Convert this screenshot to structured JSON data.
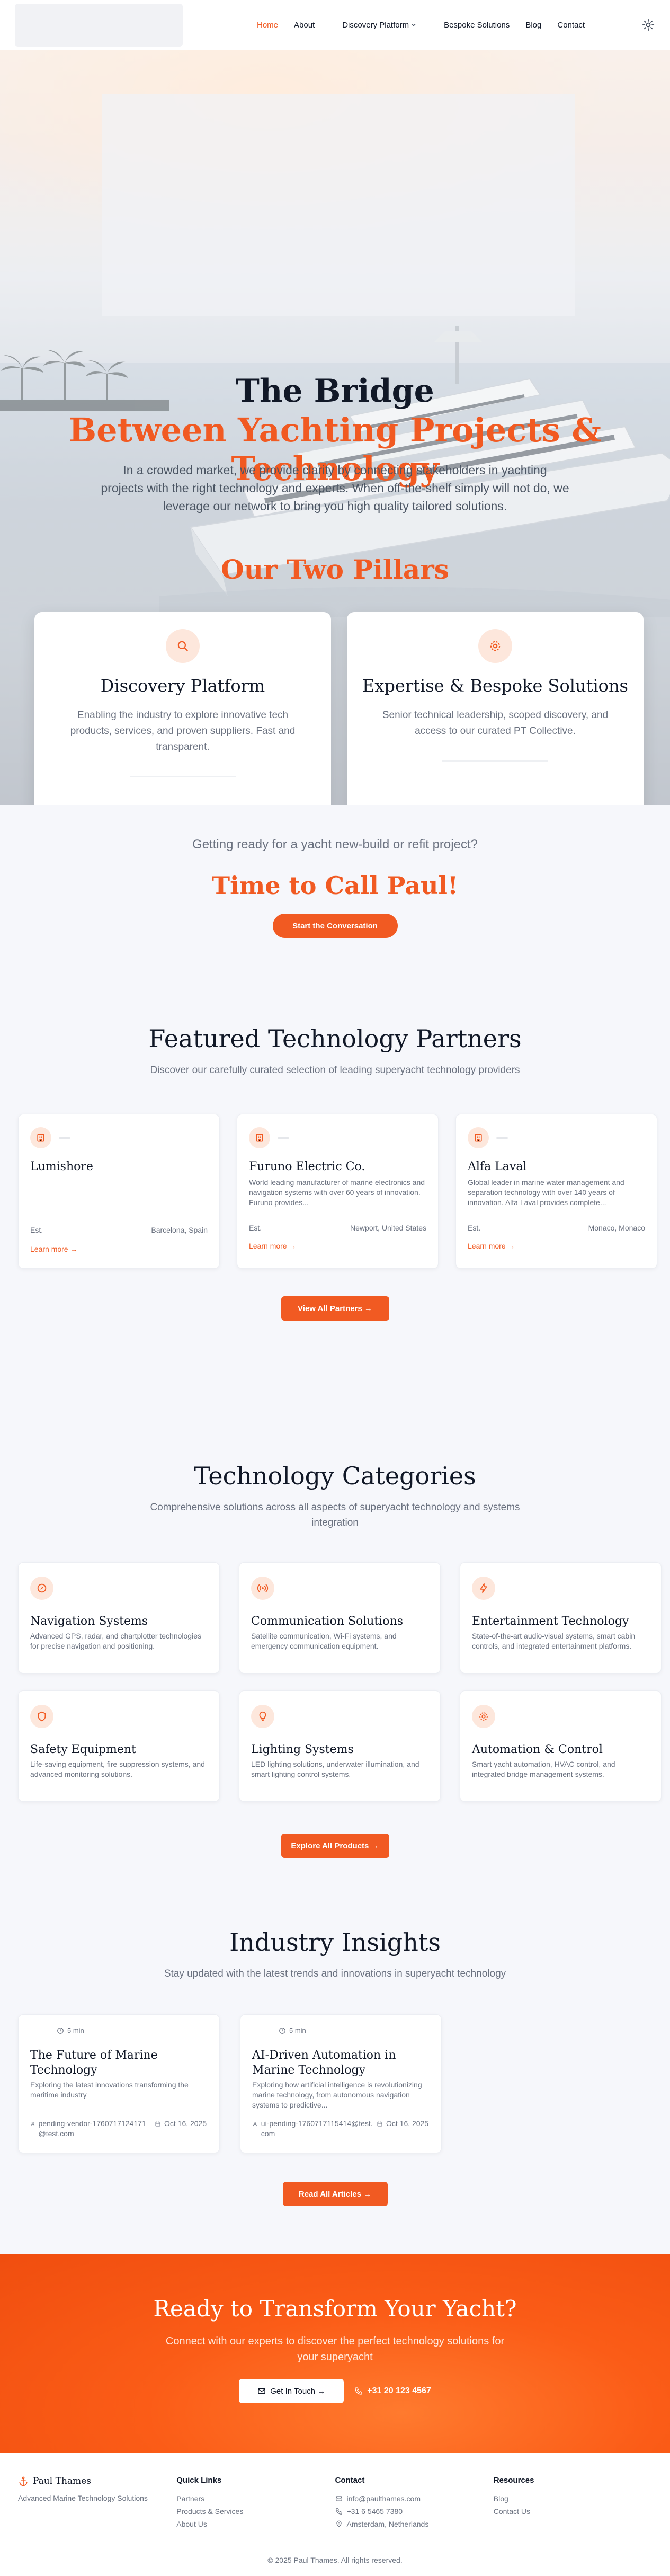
{
  "nav": {
    "items": [
      "Home",
      "About",
      "Discovery Platform",
      "Bespoke Solutions",
      "Blog",
      "Contact"
    ],
    "active": "Home"
  },
  "hero": {
    "title_line1": "The Bridge",
    "title_line2": "Between Yachting Projects & Technology",
    "intro": "In a crowded market, we provide clarity by connecting stakeholders in yachting projects with the right technology and experts. When off-the-shelf simply will not do, we leverage our network to bring you high quality tailored solutions.",
    "pillars_heading": "Our Two Pillars",
    "pillars": [
      {
        "title": "Discovery Platform",
        "text": "Enabling the industry to explore innovative tech products, services, and proven suppliers. Fast and transparent.",
        "icon": "search-icon"
      },
      {
        "title": "Expertise & Bespoke Solutions",
        "text": "Senior technical leadership, scoped discovery, and access to our curated PT Collective.",
        "icon": "gear-icon"
      }
    ]
  },
  "call": {
    "question": "Getting ready for a yacht new-build or refit project?",
    "headline": "Time to Call Paul!",
    "button": "Start the Conversation"
  },
  "partners": {
    "title": "Featured Technology Partners",
    "subtitle": "Discover our carefully curated selection of leading superyacht technology providers",
    "items": [
      {
        "name": "Lumishore",
        "desc": "",
        "est": "Est.",
        "location": "Barcelona, Spain",
        "more": "Learn more →"
      },
      {
        "name": "Furuno Electric Co.",
        "desc": "World leading manufacturer of marine electronics and navigation systems with over 60 years of innovation. Furuno provides...",
        "est": "Est.",
        "location": "Newport, United States",
        "more": "Learn more →"
      },
      {
        "name": "Alfa Laval",
        "desc": "Global leader in marine water management and separation technology with over 140 years of innovation. Alfa Laval provides complete...",
        "est": "Est.",
        "location": "Monaco, Monaco",
        "more": "Learn more →"
      }
    ],
    "button": "View All Partners →"
  },
  "categories": {
    "title": "Technology Categories",
    "subtitle": "Comprehensive solutions across all aspects of superyacht technology and systems integration",
    "items": [
      {
        "name": "Navigation Systems",
        "desc": "Advanced GPS, radar, and chartplotter technologies for precise navigation and positioning.",
        "icon": "compass-icon"
      },
      {
        "name": "Communication Solutions",
        "desc": "Satellite communication, Wi-Fi systems, and emergency communication equipment.",
        "icon": "antenna-icon"
      },
      {
        "name": "Entertainment Technology",
        "desc": "State-of-the-art audio-visual systems, smart cabin controls, and integrated entertainment platforms.",
        "icon": "bolt-icon"
      },
      {
        "name": "Safety Equipment",
        "desc": "Life-saving equipment, fire suppression systems, and advanced monitoring solutions.",
        "icon": "shield-icon"
      },
      {
        "name": "Lighting Systems",
        "desc": "LED lighting solutions, underwater illumination, and smart lighting control systems.",
        "icon": "bulb-icon"
      },
      {
        "name": "Automation & Control",
        "desc": "Smart yacht automation, HVAC control, and integrated bridge management systems.",
        "icon": "gear-icon"
      }
    ],
    "button": "Explore All Products →"
  },
  "insights": {
    "title": "Industry Insights",
    "subtitle": "Stay updated with the latest trends and innovations in superyacht technology",
    "items": [
      {
        "read": "5 min",
        "title": "The Future of Marine Technology",
        "desc": "Exploring the latest innovations transforming the maritime industry",
        "author": "pending-vendor-1760717124171@test.com",
        "date": "Oct 16, 2025"
      },
      {
        "read": "5 min",
        "title": "AI-Driven Automation in Marine Technology",
        "desc": "Exploring how artificial intelligence is revolutionizing marine technology, from autonomous navigation systems to predictive...",
        "author": "ui-pending-1760717115414@test.com",
        "date": "Oct 16, 2025"
      }
    ],
    "button": "Read All Articles →"
  },
  "ready": {
    "title": "Ready to Transform Your Yacht?",
    "text": "Connect with our experts to discover the perfect technology solutions for your superyacht",
    "button": "Get In Touch →",
    "phone": "+31 20 123 4567"
  },
  "footer": {
    "brand": "Paul Thames",
    "tagline": "Advanced Marine Technology Solutions",
    "quick_title": "Quick Links",
    "quick": [
      "Partners",
      "Products & Services",
      "About Us"
    ],
    "contact_title": "Contact",
    "email": "info@paulthames.com",
    "phone": "+31 6 5465 7380",
    "address": "Amsterdam, Netherlands",
    "resources_title": "Resources",
    "resources": [
      "Blog",
      "Contact Us"
    ],
    "copyright": "© 2025 Paul Thames. All rights reserved."
  },
  "colors": {
    "accent": "#f15a22",
    "accent_light": "#fde7dc",
    "cta_bg": "#fb5c17"
  }
}
